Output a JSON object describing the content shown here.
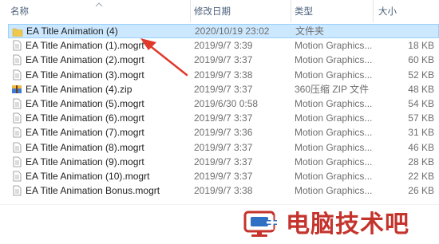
{
  "columns": {
    "name": "名称",
    "date": "修改日期",
    "type": "类型",
    "size": "大小"
  },
  "files": [
    {
      "name": "EA Title Animation (4)",
      "date": "2020/10/19 23:02",
      "type": "文件夹",
      "size": "",
      "icon": "folder-icon",
      "selected": true
    },
    {
      "name": "EA Title Animation (1).mogrt",
      "date": "2019/9/7 3:39",
      "type": "Motion Graphics...",
      "size": "18 KB",
      "icon": "file-icon"
    },
    {
      "name": "EA Title Animation (2).mogrt",
      "date": "2019/9/7 3:37",
      "type": "Motion Graphics...",
      "size": "60 KB",
      "icon": "file-icon"
    },
    {
      "name": "EA Title Animation (3).mogrt",
      "date": "2019/9/7 3:38",
      "type": "Motion Graphics...",
      "size": "52 KB",
      "icon": "file-icon"
    },
    {
      "name": "EA Title Animation (4).zip",
      "date": "2019/9/7 3:37",
      "type": "360压缩 ZIP 文件",
      "size": "48 KB",
      "icon": "zip-icon"
    },
    {
      "name": "EA Title Animation (5).mogrt",
      "date": "2019/6/30 0:58",
      "type": "Motion Graphics...",
      "size": "54 KB",
      "icon": "file-icon"
    },
    {
      "name": "EA Title Animation (6).mogrt",
      "date": "2019/9/7 3:37",
      "type": "Motion Graphics...",
      "size": "57 KB",
      "icon": "file-icon"
    },
    {
      "name": "EA Title Animation (7).mogrt",
      "date": "2019/9/7 3:36",
      "type": "Motion Graphics...",
      "size": "31 KB",
      "icon": "file-icon"
    },
    {
      "name": "EA Title Animation (8).mogrt",
      "date": "2019/9/7 3:37",
      "type": "Motion Graphics...",
      "size": "46 KB",
      "icon": "file-icon"
    },
    {
      "name": "EA Title Animation (9).mogrt",
      "date": "2019/9/7 3:37",
      "type": "Motion Graphics...",
      "size": "28 KB",
      "icon": "file-icon"
    },
    {
      "name": "EA Title Animation (10).mogrt",
      "date": "2019/9/7 3:37",
      "type": "Motion Graphics...",
      "size": "22 KB",
      "icon": "file-icon"
    },
    {
      "name": "EA Title Animation Bonus.mogrt",
      "date": "2019/9/7 3:38",
      "type": "Motion Graphics...",
      "size": "26 KB",
      "icon": "file-icon"
    }
  ],
  "watermark": {
    "text": "电脑技术吧"
  },
  "colors": {
    "selection_bg": "#cce8ff",
    "selection_border": "#99d1ff",
    "header_text": "#4c607a",
    "folder": "#f0c84c",
    "annotation_red": "#e0392b",
    "watermark_red": "#c4342c"
  }
}
